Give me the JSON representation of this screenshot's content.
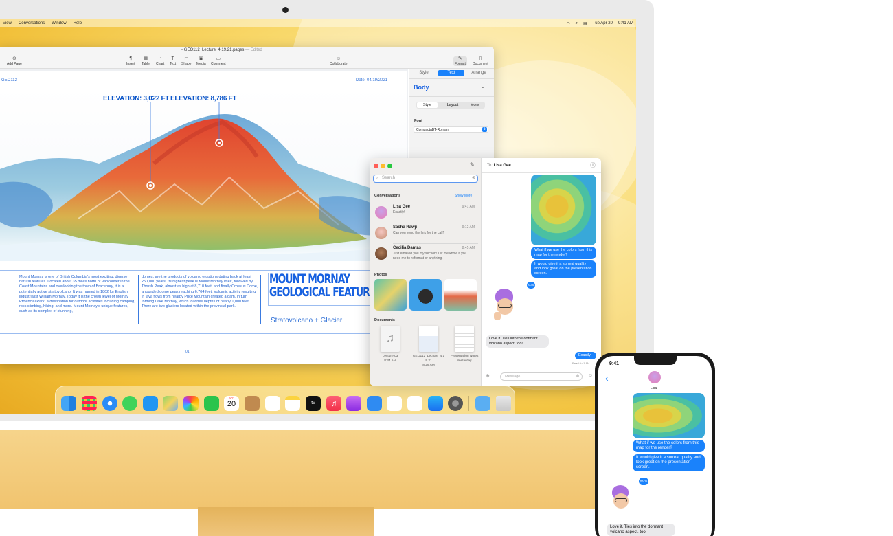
{
  "menubar": {
    "items": [
      "View",
      "Conversations",
      "Window",
      "Help"
    ],
    "date": "Tue Apr 20",
    "time": "9:41 AM"
  },
  "pages": {
    "doc_title": "GEO112_Lecture_4.19.21.pages",
    "doc_status": "— Edited",
    "toolbar": {
      "add_page": "Add Page",
      "insert": "Insert",
      "table": "Table",
      "chart": "Chart",
      "text": "Text",
      "shape": "Shape",
      "media": "Media",
      "comment": "Comment",
      "collaborate": "Collaborate",
      "format": "Format",
      "document": "Document"
    },
    "header_left": "GEO112",
    "header_right": "Date: 04/19/2021",
    "elevation1": "ELEVATION: 3,022 FT",
    "elevation2": "ELEVATION: 8,786 FT",
    "col1": "Mount Mornay is one of British Columbia's most exciting, diverse natural features. Located about 35 miles north of Vancouver in the Coast Mountains and overlooking the town of Bracebury, it is a potentially active stratovolcano. It was named in 1862 for English industrialist William Mornay. Today it is the crown jewel of Mornay Provincial Park, a destination for outdoor activities including camping, rock climbing, hiking, and more. Mount Mornay's unique features, such as its complex of stunning,",
    "col2": "domes, are the products of volcanic eruptions dating back at least 250,000 years. Its highest peak is Mount Mornay itself, followed by Thrush Peak, almost as high at 8,710 feet, and finally Croesus Dome, a rounded dome peak reaching 6,704 feet. Volcanic activity resulting in lava flows from nearby Price Mountain created a dam, in turn forming Lake Mornay, which touches depths of nearly 1,000 feet. There are two glaciers located within the provincial park.",
    "title_line1": "MOUNT MORNAY",
    "title_line2": "GEOLOGICAL FEATURES",
    "subtitle": "Stratovolcano + Glacier",
    "page_number": "01",
    "inspector": {
      "tab_style": "Style",
      "tab_text": "Text",
      "tab_arrange": "Arrange",
      "paragraph_style": "Body",
      "seg_style": "Style",
      "seg_layout": "Layout",
      "seg_more": "More",
      "font_label": "Font",
      "font_value": "CompactaBT-Roman"
    }
  },
  "messages": {
    "search_placeholder": "Search",
    "conversations_label": "Conversations",
    "show_more": "Show More",
    "conversations": [
      {
        "name": "Lisa Gee",
        "time": "9:41 AM",
        "preview": "Exactly!"
      },
      {
        "name": "Sasha Rawji",
        "time": "9:12 AM",
        "preview": "Can you send the link for the call?"
      },
      {
        "name": "Cecilia Dantas",
        "time": "8:45 AM",
        "preview": "Just emailed you my section! Let me know if you need me to reformat or anything."
      }
    ],
    "photos_label": "Photos",
    "documents_label": "Documents",
    "documents": [
      {
        "name": "Lecture 03",
        "date": "8:34 AM"
      },
      {
        "name": "GEO112_Lecture_4.19.21",
        "date": "8:29 AM"
      },
      {
        "name": "Presentation Notes",
        "date": "Yesterday"
      }
    ],
    "to_label": "To:",
    "to_name": "Lisa Gee",
    "bubble1": "What if we use the colors from this map for the render?",
    "bubble2": "It would give it a surreal quality and look great on the presentation screen.",
    "tapback": "HA HA",
    "reply": "Love it. Ties into the dormant volcano aspect, too!",
    "exactly": "Exactly!",
    "read": "Read 9:41 AM",
    "message_placeholder": "Message"
  },
  "dock": {
    "calendar_month": "APR",
    "calendar_day": "20",
    "tv_label": "tv"
  },
  "iphone": {
    "time": "9:41",
    "contact": "Lisa",
    "bubble1": "What if we use the colors from this map for the render?",
    "bubble2": "It would give it a surreal quality and look great on the presentation screen.",
    "tapback": "HA HA",
    "reply": "Love it. Ties into the dormant volcano aspect, too!"
  },
  "colors": {
    "accent": "#1a82fb",
    "doc_blue": "#1660e0",
    "imac_yellow": "#f4c541"
  }
}
